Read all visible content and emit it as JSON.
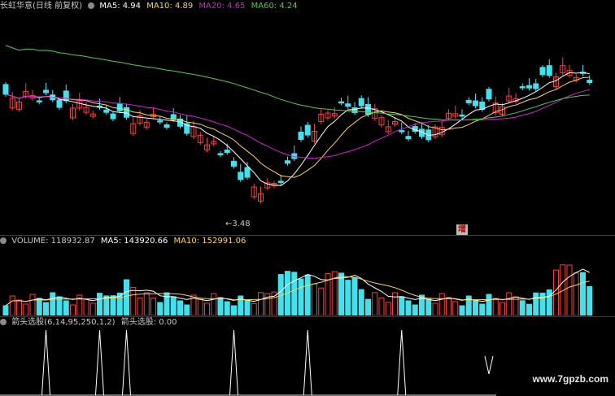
{
  "colors": {
    "up": "#ff3b3b",
    "down": "#3ee3ee",
    "ma5": "#ffffff",
    "ma10": "#ffd54f",
    "ma20": "#d61fd6",
    "ma60": "#4cd03c",
    "separator": "#8b1a1a",
    "text": "#c8c8c8"
  },
  "price_panel": {
    "title": "长虹华意(日线 前复权)",
    "ma5_label": "MA5: 4.94",
    "ma10_label": "MA10: 4.89",
    "ma20_label": "MA20: 4.65",
    "ma60_label": "MA60: 4.24",
    "low_annotation": "←3.48",
    "marker_label": "增"
  },
  "volume_panel": {
    "volume_label": "VOLUME: 118932.87",
    "ma5_label": "MA5: 143920.66",
    "ma10_label": "MA10: 152991.06"
  },
  "indicator_panel": {
    "formula_label": "箭头选股(6,14,95,250,1,2)",
    "value_label": "箭头选股: 0.00"
  },
  "watermark": "www.7gpzb.com",
  "chart_data": [
    {
      "type": "candlestick",
      "ylabel": "",
      "low_marker": 3.48,
      "series": [
        {
          "name": "MA5",
          "color": "#ffffff",
          "last": 4.94
        },
        {
          "name": "MA10",
          "color": "#ffd54f",
          "last": 4.89
        },
        {
          "name": "MA20",
          "color": "#d61fd6",
          "last": 4.65
        },
        {
          "name": "MA60",
          "color": "#4cd03c",
          "last": 4.24
        }
      ]
    },
    {
      "type": "bar",
      "series": [
        {
          "name": "VOLUME",
          "last": 118932.87
        },
        {
          "name": "MA5",
          "last": 143920.66
        },
        {
          "name": "MA10",
          "last": 152991.06
        }
      ]
    },
    {
      "type": "line",
      "series": [
        {
          "name": "箭头选股",
          "last": 0.0,
          "signal_bars": [
            6,
            14,
            18,
            34,
            45,
            59,
            72
          ]
        }
      ]
    }
  ]
}
